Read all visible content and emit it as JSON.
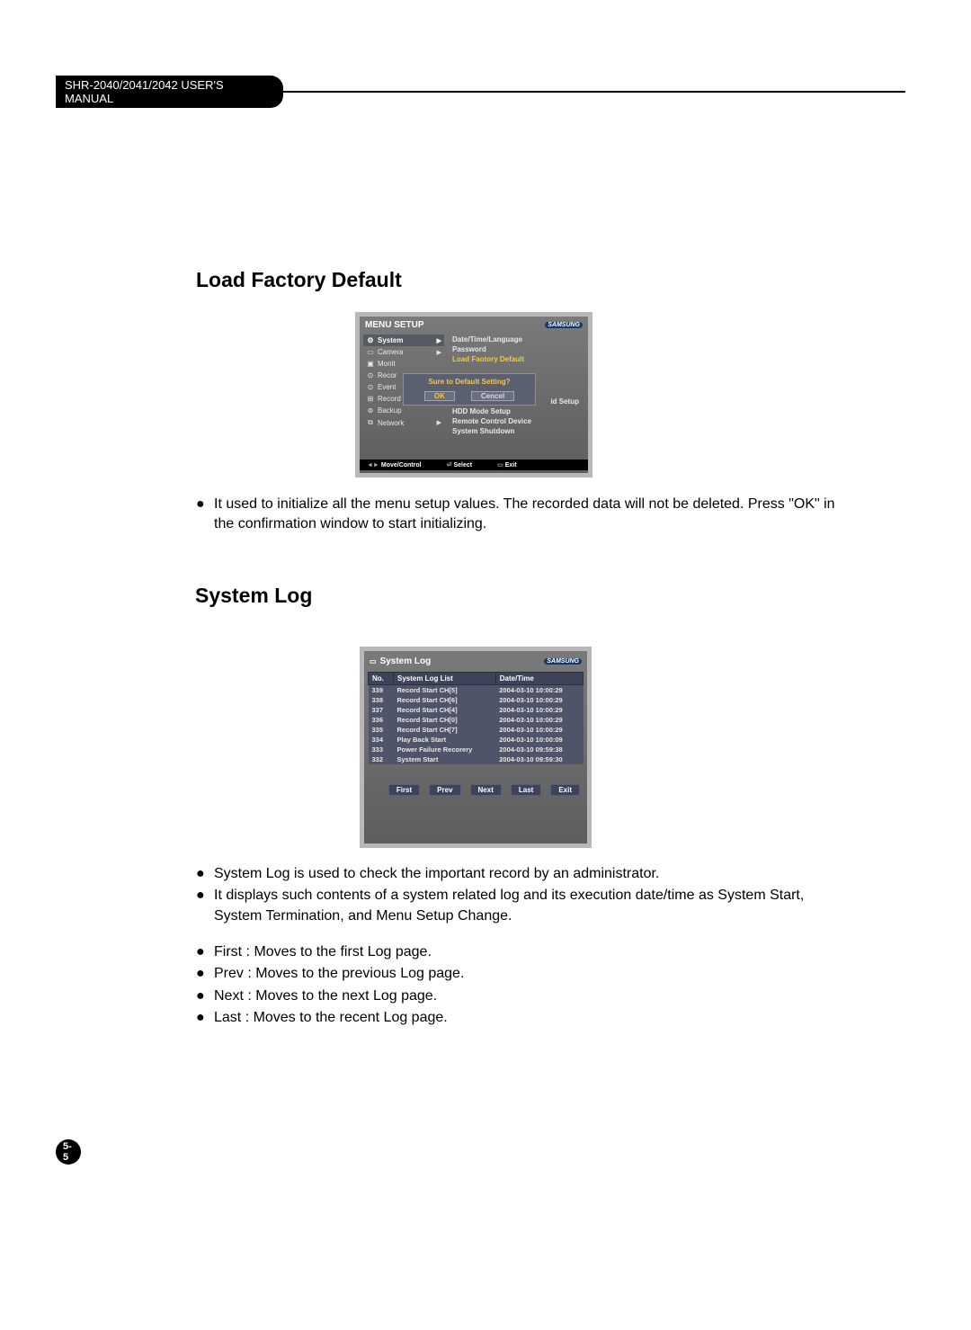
{
  "header": {
    "manual_title": "SHR-2040/2041/2042 USER'S MANUAL"
  },
  "section1": {
    "title": "Load Factory Default",
    "screenshot": {
      "window_title": "MENU SETUP",
      "brand": "SAMSUNG",
      "menu_items": [
        {
          "icon": "⚙",
          "label": "System",
          "arrow": true,
          "selected": true
        },
        {
          "icon": "📷",
          "label": "Camera",
          "arrow": true
        },
        {
          "icon": "▣",
          "label": "Monit"
        },
        {
          "icon": "⊙",
          "label": "Recor"
        },
        {
          "icon": "⊙",
          "label": "Event"
        },
        {
          "icon": "⊞",
          "label": "Record Schedule"
        },
        {
          "icon": "⊚",
          "label": "Backup"
        },
        {
          "icon": "⧉",
          "label": "Network",
          "arrow": true
        }
      ],
      "sub_items_top": [
        "Date/Time/Language",
        "Password",
        "Load Faotory Default"
      ],
      "sub_items_bottom": [
        "HDD Mode Setup",
        "Remote Control Device",
        "System Shutdown"
      ],
      "dialog": {
        "title": "Sure to Default Setting?",
        "ok": "OK",
        "cancel": "Cencel"
      },
      "setup_tail": "id Setup",
      "footer": {
        "move": "Move/Control",
        "select": "Select",
        "exit": "Exit"
      }
    },
    "bullets": [
      "It used to initialize all the menu setup values. The recorded data will not be deleted. Press \"OK\" in the confirmation window to start initializing."
    ]
  },
  "section2": {
    "title": "System Log",
    "screenshot": {
      "window_title": "System Log",
      "brand": "SAMSUNG",
      "columns": [
        "No.",
        "System Log List",
        "Date/Time"
      ],
      "rows": [
        {
          "no": "339",
          "log": "Record Start CH[5]",
          "dt": "2004-03-10 10:00:29"
        },
        {
          "no": "338",
          "log": "Record Start CH[6]",
          "dt": "2004-03-10 10:00:29"
        },
        {
          "no": "337",
          "log": "Record Start CH[4]",
          "dt": "2004-03-10 10:00:29"
        },
        {
          "no": "336",
          "log": "Record Start CH[0]",
          "dt": "2004-03-10 10:00:29"
        },
        {
          "no": "335",
          "log": "Record Start CH[7]",
          "dt": "2004-03-10 10:00:29"
        },
        {
          "no": "334",
          "log": "Play Back Start",
          "dt": "2004-03-10 10:00:09"
        },
        {
          "no": "333",
          "log": "Power Failure Recorery",
          "dt": "2004-03-10 09:59:38"
        },
        {
          "no": "332",
          "log": "System Start",
          "dt": "2004-03-10 09:59:30"
        }
      ],
      "buttons": [
        "First",
        "Prev",
        "Next",
        "Last",
        "Exit"
      ]
    },
    "bullets_a": [
      "System Log is used to check the important record by an administrator.",
      "It displays such contents of a system related log and its execution date/time as System Start, System Termination, and Menu Setup Change."
    ],
    "bullets_b": [
      "First  : Moves to the first Log page.",
      "Prev : Moves to the previous Log page.",
      "Next : Moves to the next Log page.",
      "Last  : Moves to the recent Log page."
    ]
  },
  "page_number": "5-5"
}
